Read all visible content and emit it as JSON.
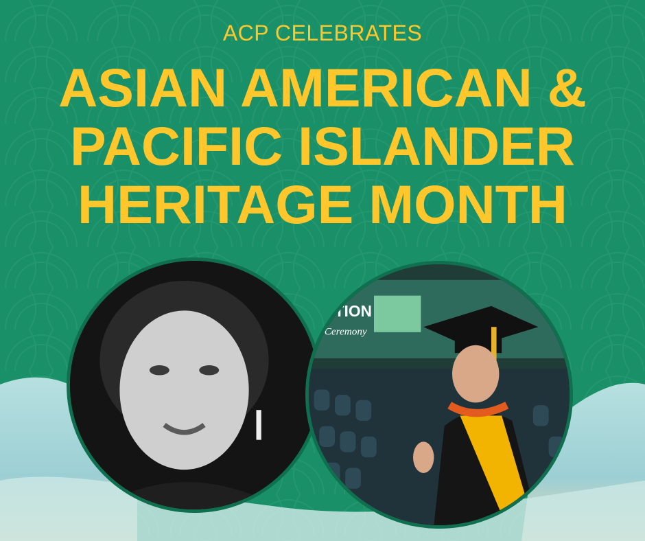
{
  "poster": {
    "subtitle": "ACP CELEBRATES",
    "title_lines": [
      "ASIAN AMERICAN &",
      "PACIFIC ISLANDER",
      "HERITAGE MONTH"
    ]
  },
  "photos": {
    "left_description_icon": "portrait-photo",
    "right_banner_text": [
      "ATION",
      "Ceremony"
    ]
  },
  "colors": {
    "background": "#1a9068",
    "accent": "#ffc72c",
    "wave": "#a8d6d8"
  }
}
